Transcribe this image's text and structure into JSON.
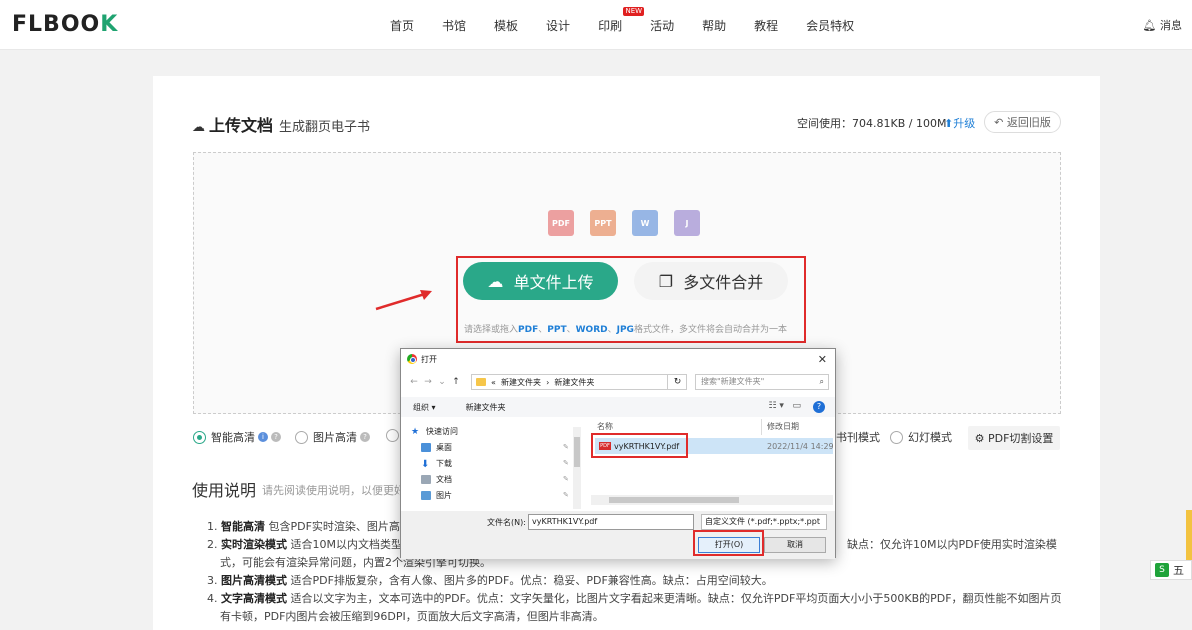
{
  "header": {
    "logo_main": "FLBOO",
    "logo_bracket": "K",
    "nav": [
      "首页",
      "书馆",
      "模板",
      "设计",
      "印刷",
      "活动",
      "帮助",
      "教程",
      "会员特权"
    ],
    "new_badge": "NEW",
    "messages": "消息"
  },
  "upload": {
    "title": "上传文档",
    "subtitle": "生成翻页电子书",
    "space_label": "空间使用：704.81KB / 100M",
    "upgrade": "升级",
    "old_version": "返回旧版",
    "file_types": [
      "PDF",
      "PPT",
      "W",
      "J"
    ],
    "single_btn": "单文件上传",
    "multi_btn": "多文件合并",
    "hint_pre": "请选择或拖入",
    "hint_pdf": "PDF",
    "hint_ppt": "PPT",
    "hint_word": "WORD",
    "hint_jpg": "JPG",
    "hint_post": "格式文件，多文件将会自动合并为一本",
    "sep1": "、",
    "sep2": "、",
    "sep3": "、"
  },
  "modes": {
    "smart": "智能高清",
    "image": "图片高清",
    "magazine": "书刊模式",
    "slide": "幻灯模式",
    "cut": "PDF切割设置"
  },
  "usage": {
    "title": "使用说明",
    "subtitle": "请先阅读使用说明，以便更好",
    "items": [
      {
        "num": "1.",
        "name": "智能高清",
        "text": " 包含PDF实时渲染、图片高清"
      },
      {
        "num": "2.",
        "name": "实时渲染模式",
        "text": " 适合10M以内文档类型，",
        "text2": "缺点：仅允许10M以内PDF使用实时渲染模",
        "line2": "式，可能会有渲染异常问题，内置2个渲染引擎可切换。"
      },
      {
        "num": "3.",
        "name": "图片高清模式",
        "text": " 适合PDF排版复杂，含有人像、图片多的PDF。优点：稳妥、PDF兼容性高。缺点：占用空间较大。"
      },
      {
        "num": "4.",
        "name": "文字高清模式",
        "text": " 适合以文字为主，文本可选中的PDF。优点：文字矢量化，比图片文字看起来更清晰。缺点：仅允许PDF平均页面大小小于500KB的PDF，翻页性能不如图片页面，略",
        "line2": "有卡顿，PDF内图片会被压缩到96DPI，页面放大后文字高清，但图片非高清。"
      }
    ]
  },
  "side_tab": {
    "icon": "S",
    "label": "五"
  },
  "dialog": {
    "title": "打开",
    "close": "✕",
    "path_prefix": "«",
    "path1": "新建文件夹",
    "path_sep": "›",
    "path2": "新建文件夹",
    "search_placeholder": "搜索\"新建文件夹\"",
    "organize": "组织 ▾",
    "new_folder": "新建文件夹",
    "help": "?",
    "sidebar": [
      "快速访问",
      "桌面",
      "下载",
      "文档",
      "图片"
    ],
    "col_name": "名称",
    "col_date": "修改日期",
    "file_name": "vyKRTHK1VY.pdf",
    "file_date": "2022/11/4 14:29",
    "filename_label": "文件名(N):",
    "filename_value": "vyKRTHK1VY.pdf",
    "filter": "自定义文件 (*.pdf;*.pptx;*.ppt",
    "open_btn": "打开(O)",
    "cancel_btn": "取消"
  },
  "colors": {
    "primary": "#2aa889",
    "link": "#1f7fd6",
    "highlight": "#e02b2b"
  }
}
